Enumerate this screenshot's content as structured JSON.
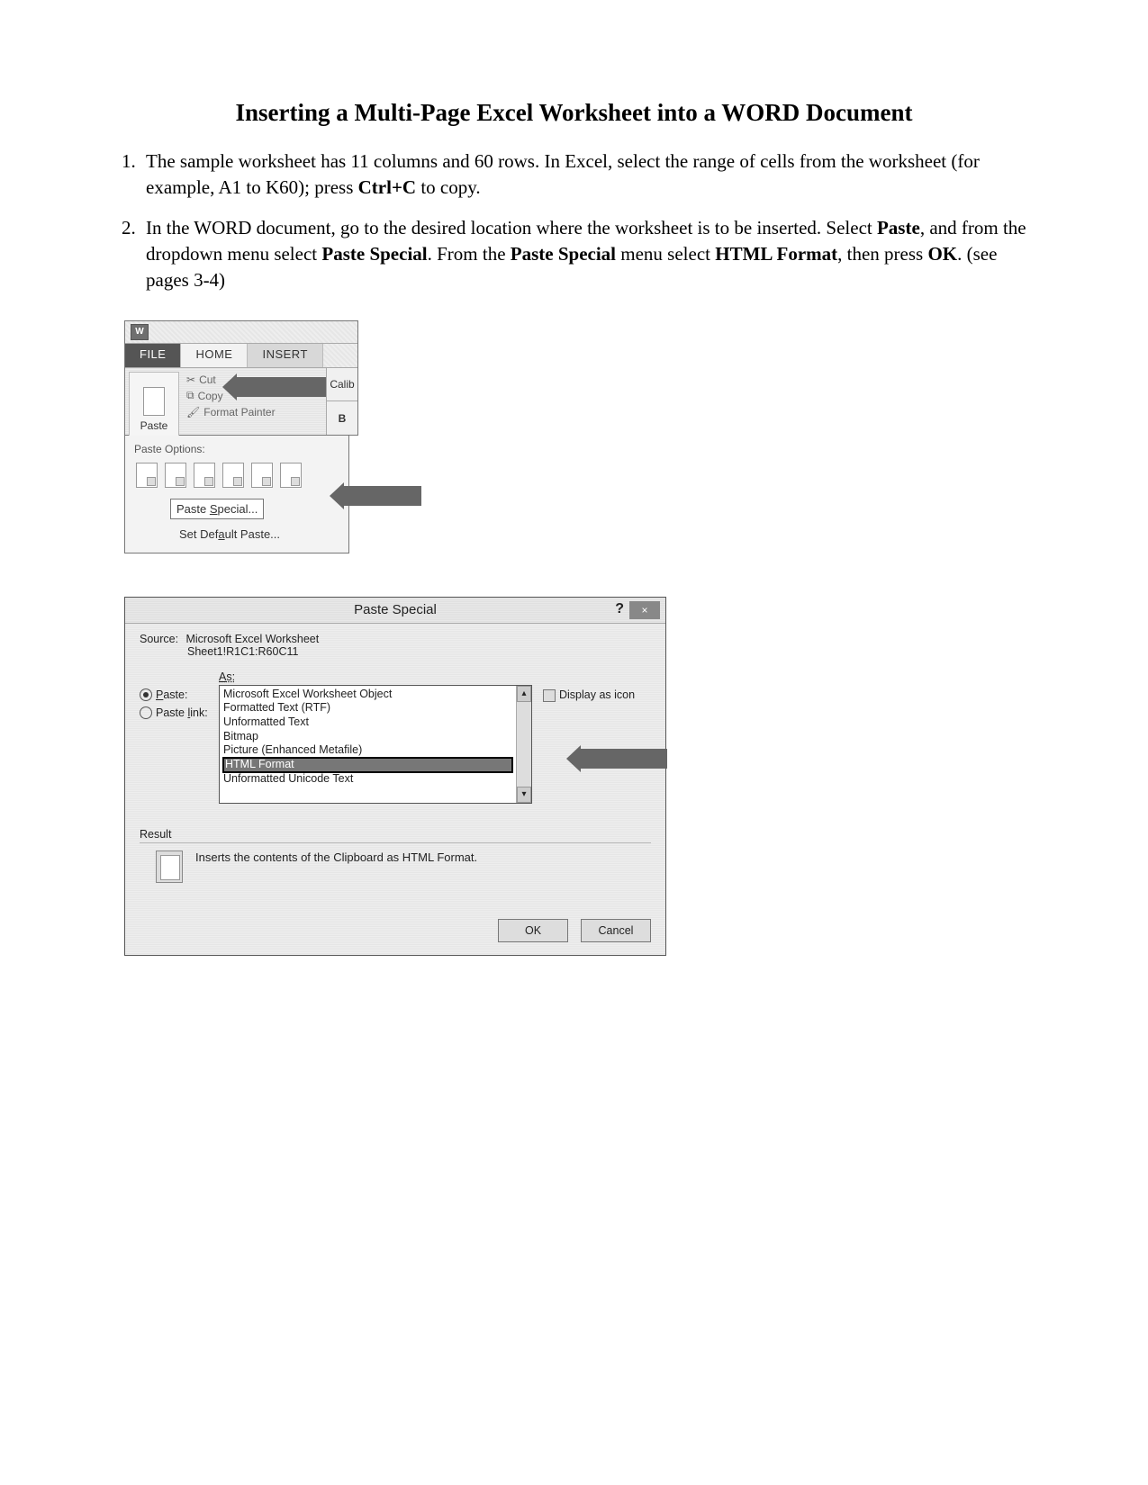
{
  "title": "Inserting a Multi-Page Excel Worksheet into a WORD Document",
  "steps": {
    "s1_a": "The sample worksheet has 11 columns and 60 rows. In Excel, select the range of cells from the worksheet (for example, A1 to K60); press ",
    "s1_b": "Ctrl+C",
    "s1_c": " to copy.",
    "s2_a": "In the WORD document, go to the desired location where the worksheet is to be inserted. Select ",
    "s2_b": "Paste",
    "s2_c": ", and from the dropdown menu select ",
    "s2_d": "Paste Special",
    "s2_e": ". From the ",
    "s2_f": "Paste Special",
    "s2_g": " menu select ",
    "s2_h": "HTML Format",
    "s2_i": ", then press ",
    "s2_j": "OK",
    "s2_k": ". (see pages 3-4)"
  },
  "ribbon": {
    "app_icon": "W",
    "tabs": {
      "file": "FILE",
      "home": "HOME",
      "insert": "INSERT"
    },
    "paste_btn": "Paste",
    "cut": "Cut",
    "copy": "Copy",
    "format_painter": "Format Painter",
    "font_name": "Calib",
    "bold": "B",
    "paste_options_hdr": "Paste Options:",
    "paste_special": "Paste Special...",
    "set_default": "Set Default Paste..."
  },
  "dialog": {
    "title": "Paste Special",
    "help": "?",
    "close": "×",
    "source_lbl": "Source:",
    "source_val": "Microsoft Excel Worksheet",
    "source_ref": "Sheet1!R1C1:R60C11",
    "as_lbl": "As:",
    "paste_radio": "Paste:",
    "paste_link_radio": "Paste link:",
    "list": [
      "Microsoft Excel Worksheet Object",
      "Formatted Text (RTF)",
      "Unformatted Text",
      "Bitmap",
      "Picture (Enhanced Metafile)",
      "HTML Format",
      "Unformatted Unicode Text"
    ],
    "display_as_icon": "Display as icon",
    "result_lbl": "Result",
    "result_text": "Inserts the contents of the Clipboard as HTML Format.",
    "ok": "OK",
    "cancel": "Cancel"
  }
}
